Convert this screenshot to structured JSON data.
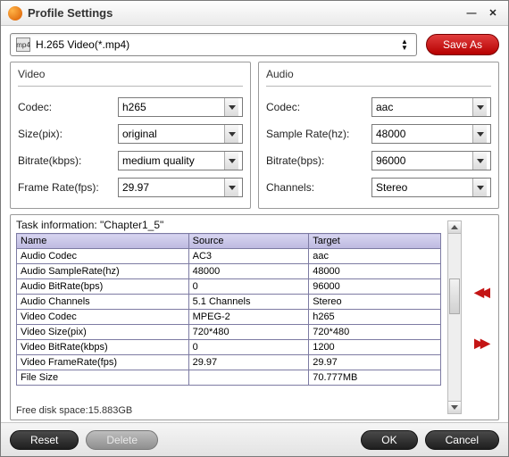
{
  "window": {
    "title": "Profile Settings"
  },
  "profile": {
    "icon_label": "mp4",
    "text": "H.265 Video(*.mp4)",
    "save_as": "Save As"
  },
  "video": {
    "heading": "Video",
    "codec_label": "Codec:",
    "codec_value": "h265",
    "size_label": "Size(pix):",
    "size_value": "original",
    "bitrate_label": "Bitrate(kbps):",
    "bitrate_value": "medium quality",
    "framerate_label": "Frame Rate(fps):",
    "framerate_value": "29.97"
  },
  "audio": {
    "heading": "Audio",
    "codec_label": "Codec:",
    "codec_value": "aac",
    "samplerate_label": "Sample Rate(hz):",
    "samplerate_value": "48000",
    "bitrate_label": "Bitrate(bps):",
    "bitrate_value": "96000",
    "channels_label": "Channels:",
    "channels_value": "Stereo"
  },
  "task": {
    "info": "Task information: \"Chapter1_5\"",
    "headers": {
      "name": "Name",
      "source": "Source",
      "target": "Target"
    },
    "rows": [
      {
        "name": "Audio Codec",
        "source": "AC3",
        "target": "aac"
      },
      {
        "name": "Audio SampleRate(hz)",
        "source": "48000",
        "target": "48000"
      },
      {
        "name": "Audio BitRate(bps)",
        "source": "0",
        "target": "96000"
      },
      {
        "name": "Audio Channels",
        "source": "5.1 Channels",
        "target": "Stereo"
      },
      {
        "name": "Video Codec",
        "source": "MPEG-2",
        "target": "h265"
      },
      {
        "name": "Video Size(pix)",
        "source": "720*480",
        "target": "720*480"
      },
      {
        "name": "Video BitRate(kbps)",
        "source": "0",
        "target": "1200"
      },
      {
        "name": "Video FrameRate(fps)",
        "source": "29.97",
        "target": "29.97"
      },
      {
        "name": "File Size",
        "source": "",
        "target": "70.777MB"
      }
    ],
    "free_disk": "Free disk space:15.883GB"
  },
  "footer": {
    "reset": "Reset",
    "delete": "Delete",
    "ok": "OK",
    "cancel": "Cancel"
  }
}
